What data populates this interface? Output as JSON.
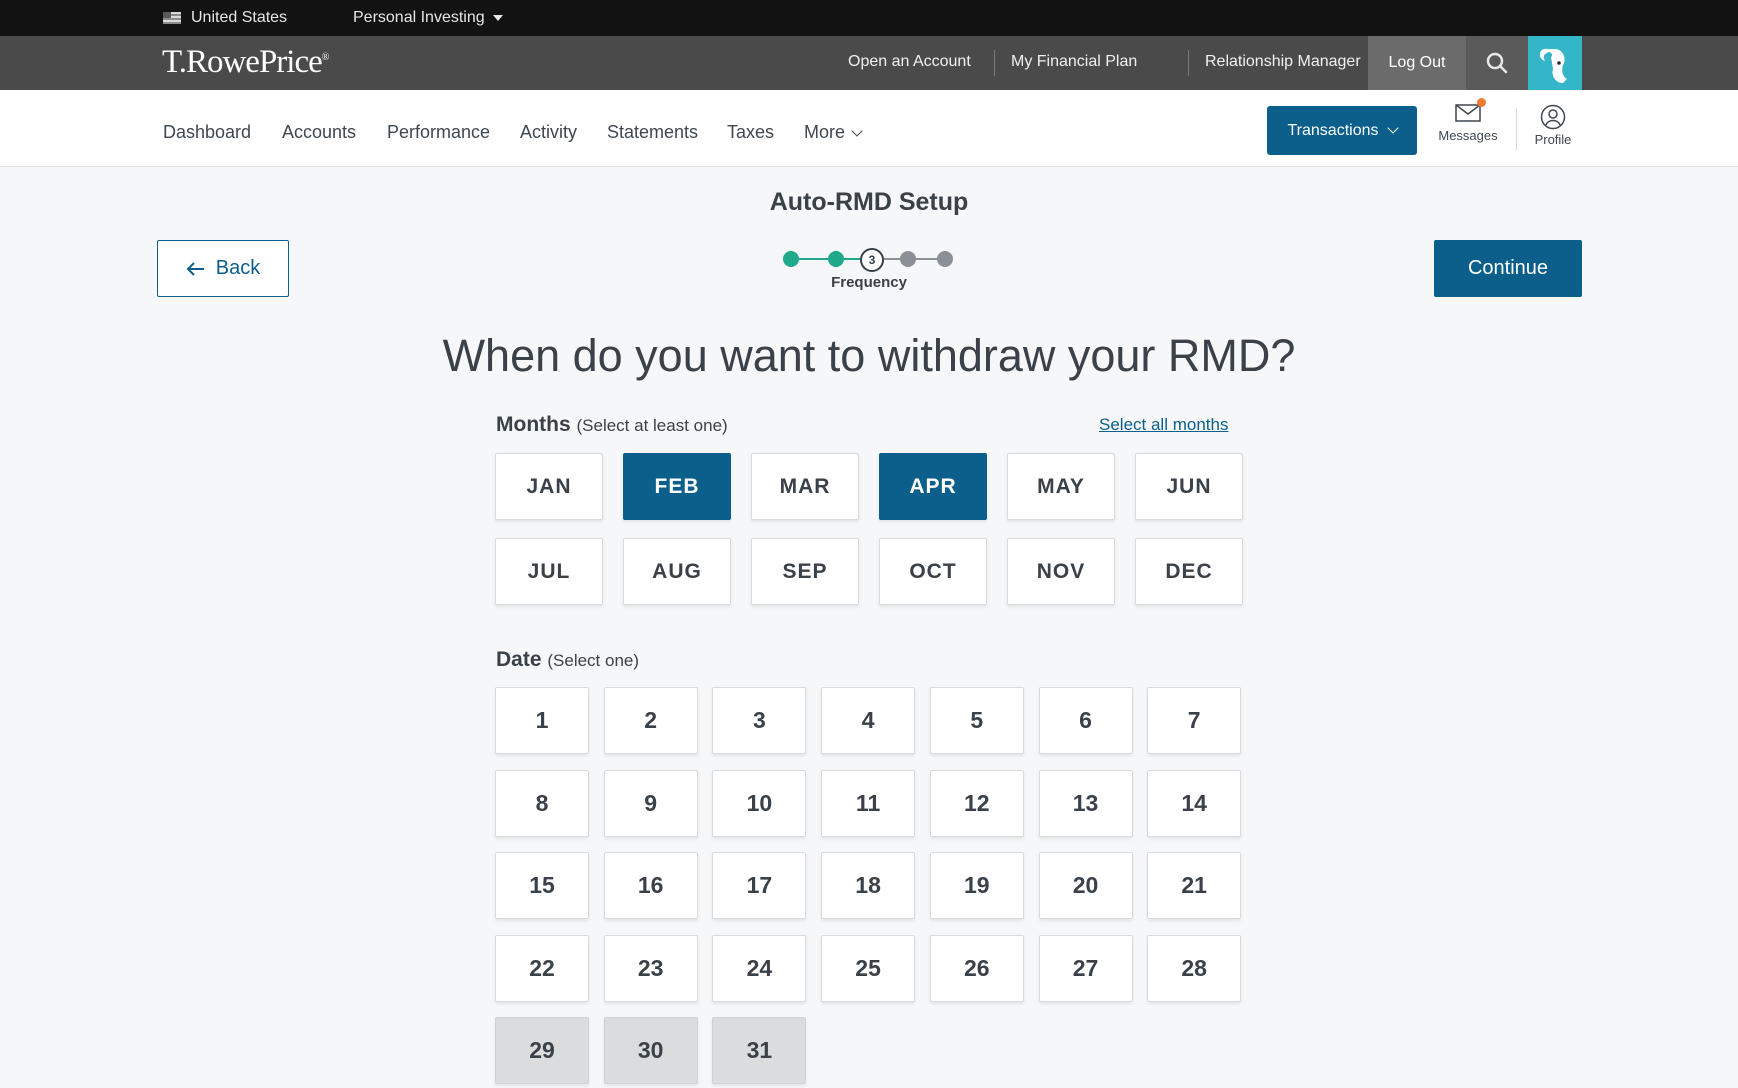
{
  "topbar": {
    "country": "United States",
    "segment": "Personal Investing"
  },
  "brand": {
    "logo": "T.RowePrice",
    "links": [
      "Open an Account",
      "My Financial Plan",
      "Relationship Manager"
    ],
    "logout": "Log Out"
  },
  "nav": {
    "items": [
      "Dashboard",
      "Accounts",
      "Performance",
      "Activity",
      "Statements",
      "Taxes",
      "More"
    ],
    "transactions": "Transactions",
    "messages": "Messages",
    "profile": "Profile"
  },
  "page": {
    "title": "Auto-RMD Setup",
    "back": "Back",
    "continue": "Continue",
    "step_current": "3",
    "step_label": "Frequency",
    "question": "When do you want to withdraw your RMD?"
  },
  "months_section": {
    "label": "Months",
    "hint": "(Select at least one)",
    "select_all": "Select all months",
    "months": [
      {
        "label": "JAN",
        "selected": false
      },
      {
        "label": "FEB",
        "selected": true
      },
      {
        "label": "MAR",
        "selected": false
      },
      {
        "label": "APR",
        "selected": true
      },
      {
        "label": "MAY",
        "selected": false
      },
      {
        "label": "JUN",
        "selected": false
      },
      {
        "label": "JUL",
        "selected": false
      },
      {
        "label": "AUG",
        "selected": false
      },
      {
        "label": "SEP",
        "selected": false
      },
      {
        "label": "OCT",
        "selected": false
      },
      {
        "label": "NOV",
        "selected": false
      },
      {
        "label": "DEC",
        "selected": false
      }
    ]
  },
  "date_section": {
    "label": "Date",
    "hint": "(Select one)",
    "days": [
      "1",
      "2",
      "3",
      "4",
      "5",
      "6",
      "7",
      "8",
      "9",
      "10",
      "11",
      "12",
      "13",
      "14",
      "15",
      "16",
      "17",
      "18",
      "19",
      "20",
      "21",
      "22",
      "23",
      "24",
      "25",
      "26",
      "27",
      "28",
      "29",
      "30",
      "31"
    ],
    "disabled_days": [
      "29",
      "30",
      "31"
    ]
  },
  "colors": {
    "accent": "#0b5f8a",
    "step_done": "#1fa98a",
    "step_todo": "#8a9096",
    "badge": "#f07a32"
  }
}
